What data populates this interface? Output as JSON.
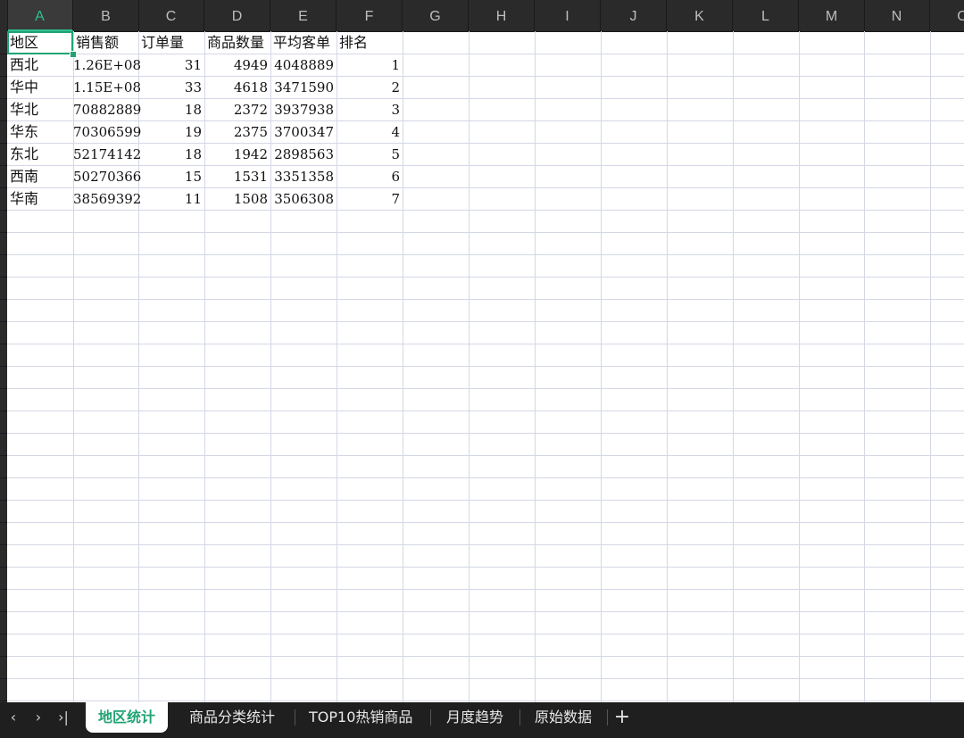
{
  "columns": [
    "A",
    "B",
    "C",
    "D",
    "E",
    "F",
    "G",
    "H",
    "I",
    "J",
    "K",
    "L",
    "M",
    "N",
    "O"
  ],
  "active_column": "A",
  "table": {
    "headers": [
      "地区",
      "销售额",
      "订单量",
      "商品数量",
      "平均客单",
      "排名"
    ],
    "rows": [
      [
        "西北",
        "1.26E+08",
        "31",
        "4949",
        "4048889",
        "1"
      ],
      [
        "华中",
        "1.15E+08",
        "33",
        "4618",
        "3471590",
        "2"
      ],
      [
        "华北",
        "70882889",
        "18",
        "2372",
        "3937938",
        "3"
      ],
      [
        "华东",
        "70306599",
        "19",
        "2375",
        "3700347",
        "4"
      ],
      [
        "东北",
        "52174142",
        "18",
        "1942",
        "2898563",
        "5"
      ],
      [
        "西南",
        "50270366",
        "15",
        "1531",
        "3351358",
        "6"
      ],
      [
        "华南",
        "38569392",
        "11",
        "1508",
        "3506308",
        "7"
      ]
    ]
  },
  "tabs": [
    {
      "label": "地区统计",
      "active": true
    },
    {
      "label": "商品分类统计",
      "active": false
    },
    {
      "label": "TOP10热销商品",
      "active": false
    },
    {
      "label": "月度趋势",
      "active": false
    },
    {
      "label": "原始数据",
      "active": false
    }
  ],
  "nav": {
    "prev": "‹",
    "next": "›",
    "last": "›|"
  },
  "add_sheet_label": "+",
  "colors": {
    "accent": "#21a373",
    "grid": "#d4d8e6",
    "header_bg": "#2a2a2a"
  }
}
